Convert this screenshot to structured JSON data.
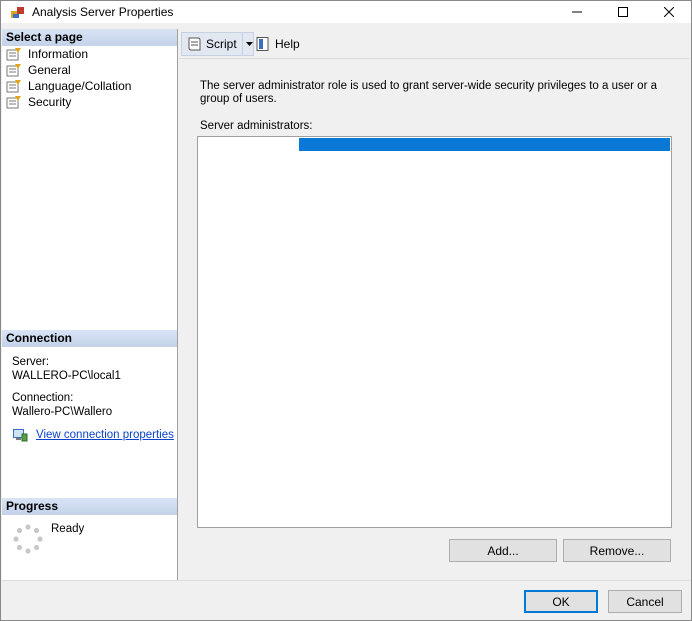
{
  "window": {
    "title": "Analysis Server Properties",
    "minimize_icon": "minimize-icon",
    "maximize_icon": "maximize-icon",
    "close_icon": "close-icon"
  },
  "select_page": {
    "header": "Select a page",
    "items": [
      {
        "label": "Information",
        "icon": "page-icon"
      },
      {
        "label": "General",
        "icon": "page-icon"
      },
      {
        "label": "Language/Collation",
        "icon": "page-icon"
      },
      {
        "label": "Security",
        "icon": "page-icon"
      }
    ]
  },
  "connection": {
    "header": "Connection",
    "server_label": "Server:",
    "server_value": "WALLERO-PC\\local1",
    "connection_label": "Connection:",
    "connection_value": "Wallero-PC\\Wallero",
    "link": "View connection properties"
  },
  "progress": {
    "header": "Progress",
    "status": "Ready"
  },
  "toolbar": {
    "script_label": "Script",
    "help_label": "Help"
  },
  "security": {
    "description": "The server administrator role is used to grant server-wide security privileges to a user or a group of users.",
    "admins_label": "Server administrators:",
    "selected_entry": "",
    "add_button": "Add...",
    "remove_button": "Remove..."
  },
  "footer": {
    "ok_button": "OK",
    "cancel_button": "Cancel"
  },
  "colors": {
    "selection": "#0a78d7",
    "link": "#0a42c9",
    "header_band": "#c3d2ea"
  }
}
